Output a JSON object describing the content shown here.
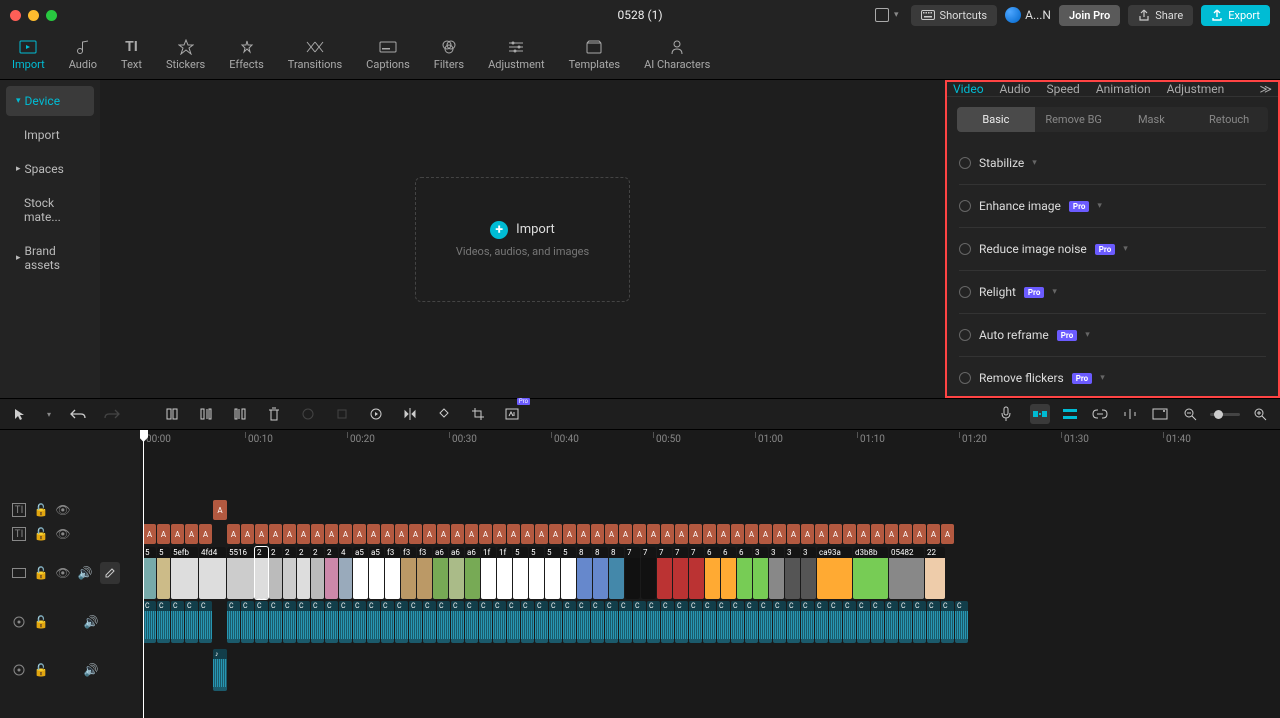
{
  "titlebar": {
    "title": "0528 (1)",
    "shortcuts": "Shortcuts",
    "user": "A...N",
    "join_pro": "Join Pro",
    "share": "Share",
    "export": "Export"
  },
  "toolbar": {
    "import": "Import",
    "audio": "Audio",
    "text": "Text",
    "stickers": "Stickers",
    "effects": "Effects",
    "transitions": "Transitions",
    "captions": "Captions",
    "filters": "Filters",
    "adjustment": "Adjustment",
    "templates": "Templates",
    "ai_characters": "AI Characters"
  },
  "left_panel": {
    "device": "Device",
    "import": "Import",
    "spaces": "Spaces",
    "stock": "Stock mate...",
    "brand": "Brand assets"
  },
  "media": {
    "import_label": "Import",
    "import_sub": "Videos, audios, and images"
  },
  "right_panel": {
    "tabs": {
      "video": "Video",
      "audio": "Audio",
      "speed": "Speed",
      "animation": "Animation",
      "adjustment": "Adjustmen"
    },
    "subtabs": {
      "basic": "Basic",
      "removebg": "Remove BG",
      "mask": "Mask",
      "retouch": "Retouch"
    },
    "options": {
      "stabilize": "Stabilize",
      "enhance": "Enhance image",
      "reduce_noise": "Reduce image noise",
      "relight": "Relight",
      "auto_reframe": "Auto reframe",
      "remove_flickers": "Remove flickers"
    },
    "pro": "Pro"
  },
  "ruler": {
    "t0": "00:00",
    "t10": "00:10",
    "t20": "00:20",
    "t30": "00:30",
    "t40": "00:40",
    "t50": "00:50",
    "t60": "01:00",
    "t70": "01:10",
    "t80": "01:20",
    "t90": "01:30",
    "t100": "01:40"
  },
  "timeline": {
    "text_clip_labels": [
      "A",
      "A",
      "A",
      "A",
      "A",
      "A",
      "A",
      "A",
      "A",
      "A",
      "A",
      "A",
      "A",
      "A",
      "A",
      "A",
      "A",
      "A",
      "A",
      "A",
      "A",
      "A",
      "A",
      "A",
      "A",
      "A",
      "A",
      "A",
      "A",
      "A",
      "A",
      "A",
      "A",
      "A",
      "A",
      "A",
      "A",
      "A",
      "A",
      "A",
      "A",
      "A",
      "A",
      "A",
      "A",
      "A",
      "A",
      "A",
      "A",
      "A",
      "A",
      "A",
      "A",
      "A",
      "A",
      "A",
      "A"
    ],
    "text2_label": "A",
    "video_labels": [
      "5",
      "5",
      "5efb",
      "4fd4",
      "5516",
      "2",
      "2",
      "2",
      "2",
      "2",
      "2",
      "4",
      "a5",
      "a5",
      "f3",
      "f3",
      "f3",
      "a6",
      "a6",
      "a6",
      "1f",
      "1f",
      "5",
      "5",
      "5",
      "5",
      "8",
      "8",
      "8",
      "7",
      "7",
      "7",
      "7",
      "7",
      "6",
      "6",
      "6",
      "3",
      "3",
      "3",
      "3",
      "ca93a",
      "d3b8b",
      "05482",
      "22"
    ],
    "audio_labels": [
      "C",
      "C",
      "C",
      "C",
      "C",
      "C",
      "C",
      "C",
      "C",
      "C",
      "C",
      "C",
      "C",
      "C",
      "C",
      "C",
      "C",
      "C",
      "C",
      "C",
      "C",
      "C",
      "C",
      "C",
      "C",
      "C",
      "C",
      "C",
      "C",
      "C",
      "C",
      "C",
      "C",
      "C",
      "C",
      "C",
      "C",
      "C",
      "C",
      "C",
      "C",
      "C",
      "C",
      "C",
      "C",
      "C",
      "C",
      "C",
      "C",
      "C",
      "C",
      "C",
      "C",
      "C",
      "C",
      "C",
      "C",
      "C"
    ]
  }
}
